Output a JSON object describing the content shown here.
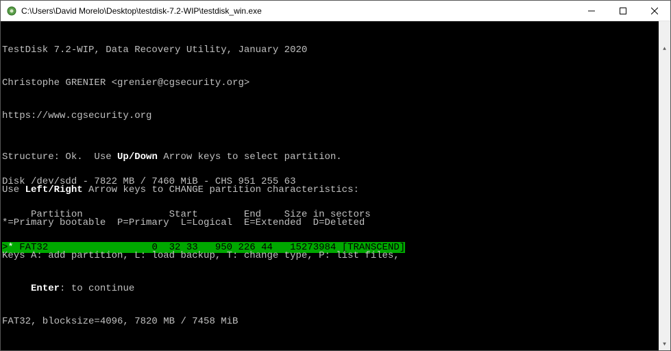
{
  "window": {
    "title": "C:\\Users\\David Morelo\\Desktop\\testdisk-7.2-WIP\\testdisk_win.exe"
  },
  "header": {
    "line1": "TestDisk 7.2-WIP, Data Recovery Utility, January 2020",
    "line2": "Christophe GRENIER <grenier@cgsecurity.org>",
    "line3": "https://www.cgsecurity.org"
  },
  "disk": {
    "info": "Disk /dev/sdd - 7822 MB / 7460 MiB - CHS 951 255 63",
    "columns": "     Partition               Start        End    Size in sectors"
  },
  "partition": {
    "marker": ">",
    "flag": "*",
    "fs": " FAT32               ",
    "start": "   0  32 33",
    "end": "   950 226 44",
    "size": "   15273984",
    "label": " [TRANSCEND]"
  },
  "footer": {
    "structure_pre": "Structure: Ok.  Use ",
    "updown": "Up/Down",
    "structure_post": " Arrow keys to select partition.",
    "leftright_pre": "Use ",
    "leftright": "Left/Right",
    "leftright_post": " Arrow keys to CHANGE partition characteristics:",
    "legend": "*=Primary bootable  P=Primary  L=Logical  E=Extended  D=Deleted",
    "keys": "Keys A: add partition, L: load backup, T: change type, P: list files,",
    "enter_pre": "     ",
    "enter": "Enter",
    "enter_post": ": to continue",
    "fsinfo": "FAT32, blocksize=4096, 7820 MB / 7458 MiB"
  }
}
